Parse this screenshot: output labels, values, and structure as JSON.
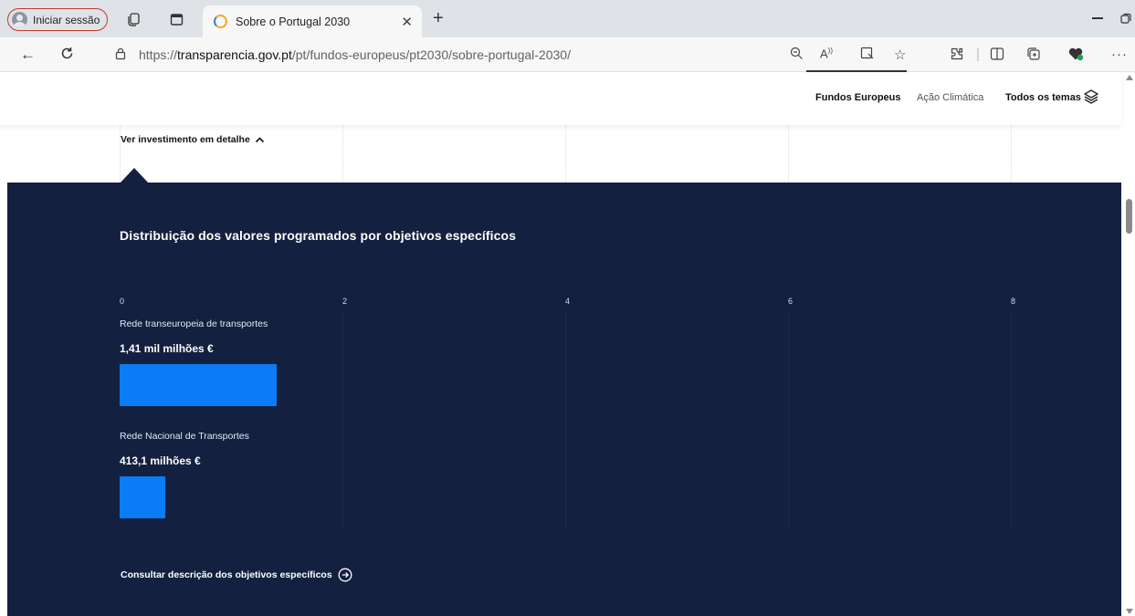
{
  "browser": {
    "profile_label": "Iniciar sessão",
    "tab_title": "Sobre o Portugal 2030",
    "url_prefix": "https://",
    "url_domain": "transparencia.gov.pt",
    "url_path": "/pt/fundos-europeus/pt2030/sobre-portugal-2030/"
  },
  "site_nav": {
    "items": [
      {
        "label": "Fundos Europeus"
      },
      {
        "label": "Ação Climática"
      },
      {
        "label": "Todos os temas"
      }
    ]
  },
  "detail_toggle_label": "Ver investimento em detalhe",
  "chart_section": {
    "title": "Distribuição dos valores programados por objetivos específicos",
    "consult_label": "Consultar descrição dos objetivos específicos"
  },
  "chart_data": {
    "type": "bar",
    "orientation": "horizontal",
    "title": "Distribuição dos valores programados por objetivos específicos",
    "xlim": [
      0,
      9.4
    ],
    "x_ticks": [
      "0",
      "2",
      "4",
      "6",
      "8"
    ],
    "categories": [
      "Rede transeuropeia de transportes",
      "Rede Nacional de Transportes"
    ],
    "values": [
      1.41,
      0.4131
    ],
    "value_labels": [
      "1,41 mil milhões €",
      "413,1 milhões €"
    ],
    "bar_color": "#0a7cf5",
    "background_color": "#13203f",
    "grid": true
  },
  "colors": {
    "panel": "#13203f",
    "accent_bar": "#0a7cf5"
  }
}
